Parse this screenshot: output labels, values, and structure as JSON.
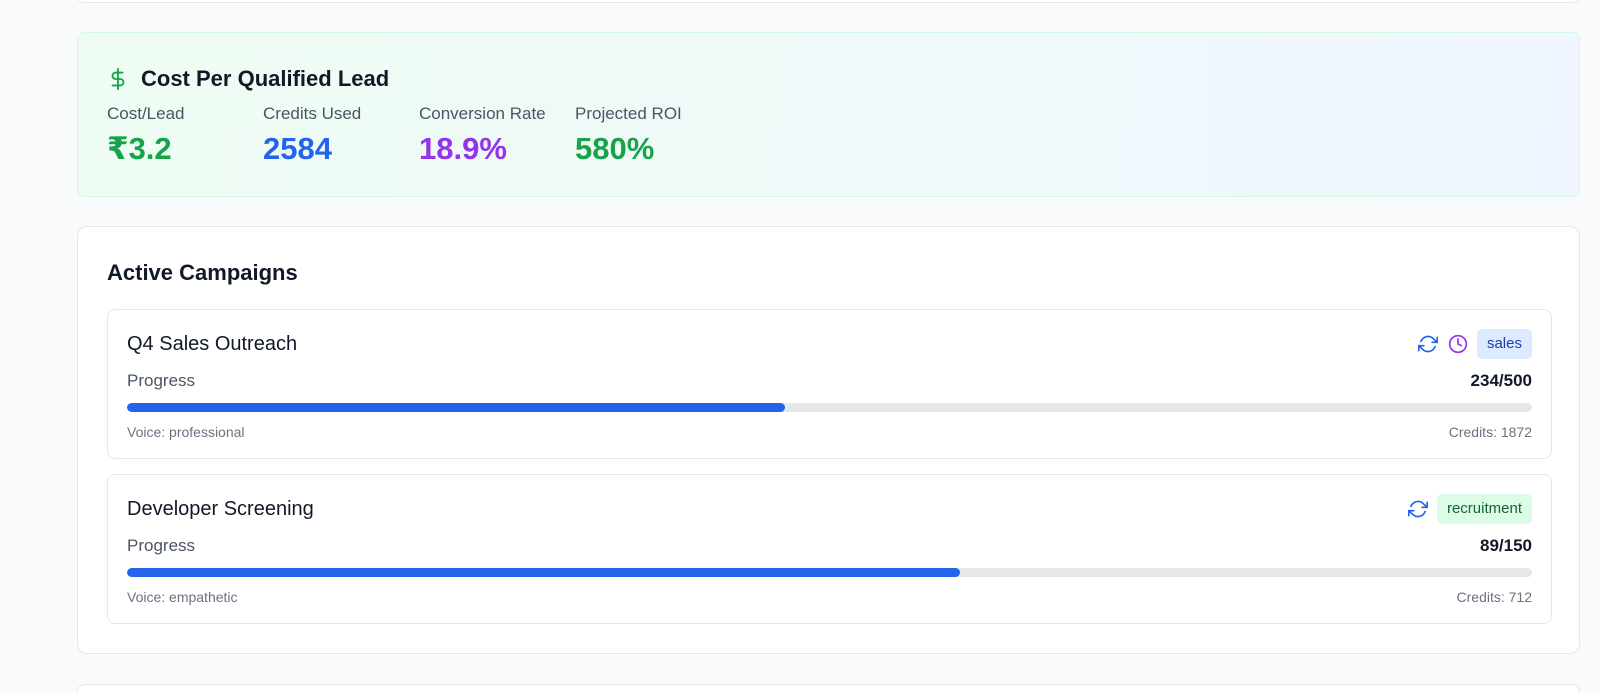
{
  "cost_card": {
    "title": "Cost Per Qualified Lead",
    "icon": "dollar-icon",
    "metrics": [
      {
        "label": "Cost/Lead",
        "value": "₹3.2",
        "color": "#16a34a"
      },
      {
        "label": "Credits Used",
        "value": "2584",
        "color": "#2563eb"
      },
      {
        "label": "Conversion Rate",
        "value": "18.9%",
        "color": "#9333ea"
      },
      {
        "label": "Projected ROI",
        "value": "580%",
        "color": "#16a34a"
      }
    ]
  },
  "campaigns": {
    "title": "Active Campaigns",
    "items": [
      {
        "name": "Q4 Sales Outreach",
        "progress_label": "Progress",
        "progress_text": "234/500",
        "progress_fraction": 0.468,
        "voice": "Voice: professional",
        "credits": "Credits: 1872",
        "tag": "sales",
        "icons": [
          "refresh-icon",
          "clock-icon"
        ]
      },
      {
        "name": "Developer Screening",
        "progress_label": "Progress",
        "progress_text": "89/150",
        "progress_fraction": 0.593,
        "voice": "Voice: empathetic",
        "credits": "Credits: 712",
        "tag": "recruitment",
        "icons": [
          "refresh-icon"
        ]
      }
    ]
  },
  "colors": {
    "accent_blue": "#2563eb",
    "green": "#16a34a",
    "purple": "#9333ea"
  }
}
